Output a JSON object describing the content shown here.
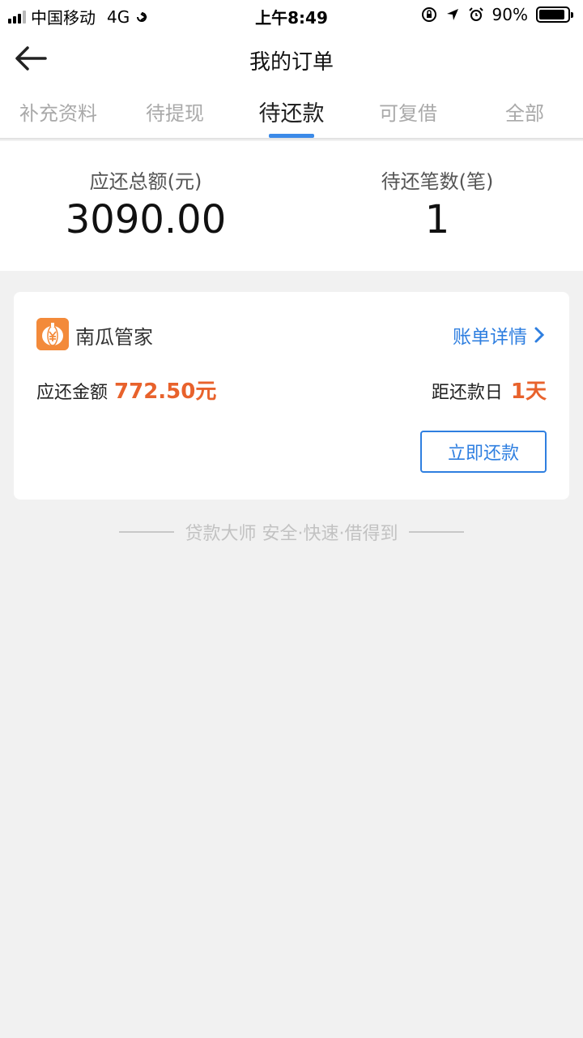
{
  "status_bar": {
    "carrier": "中国移动",
    "network": "4G",
    "time": "上午8:49",
    "battery_percent": "90%",
    "battery_level": 0.9
  },
  "nav": {
    "title": "我的订单",
    "back_icon": "arrow-left-icon"
  },
  "tabs": [
    {
      "label": "补充资料",
      "active": false
    },
    {
      "label": "待提现",
      "active": false
    },
    {
      "label": "待还款",
      "active": true
    },
    {
      "label": "可复借",
      "active": false
    },
    {
      "label": "全部",
      "active": false
    }
  ],
  "summary": {
    "total_label": "应还总额(元)",
    "total_value": "3090.00",
    "count_label": "待还笔数(笔)",
    "count_value": "1"
  },
  "order": {
    "app_name": "南瓜管家",
    "logo_icon": "pumpkin-yuan-icon",
    "detail_link": "账单详情",
    "amount_label": "应还金额",
    "amount_value": "772.50元",
    "due_label": "距还款日",
    "due_value": "1天",
    "repay_button": "立即还款"
  },
  "footer": {
    "text": "贷款大师 安全·快速·借得到"
  },
  "colors": {
    "accent": "#3b8ae8",
    "link": "#2f7fe0",
    "highlight": "#e8622c",
    "logo": "#f38a3a",
    "background": "#f1f1f1"
  }
}
